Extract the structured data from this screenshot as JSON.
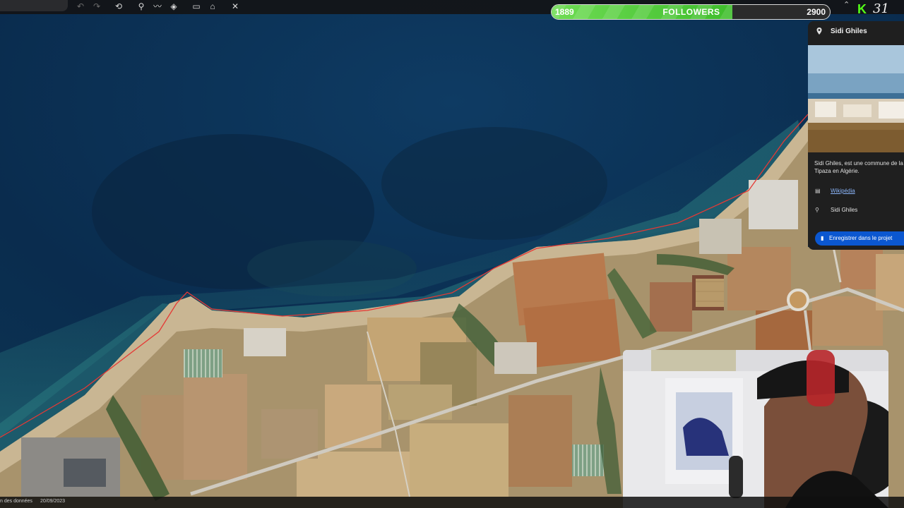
{
  "toolbar": {
    "icons": [
      "undo-icon",
      "redo-icon",
      "history-icon",
      "placemark-icon",
      "path-icon",
      "layers-icon",
      "ruler-icon",
      "street-view-icon",
      "settings-icon"
    ]
  },
  "followers_widget": {
    "current": "1889",
    "label": "FOLLOWERS",
    "goal": "2900",
    "progress": 0.651
  },
  "stream": {
    "platform_icon": "kick-logo",
    "viewer_count": "31"
  },
  "place_panel": {
    "title": "Sidi Ghiles",
    "description_lines": [
      "Sidi Ghiles, est une commune de la",
      "Tipaza en Algérie."
    ],
    "wiki_link": "Wikipédia",
    "location_label": "Sidi Ghiles",
    "save_button": "Enregistrer dans le projet"
  },
  "status_bar": {
    "data_credit": "n des données",
    "date": "20/09/2023"
  },
  "colors": {
    "accent_blue": "#0b57d0",
    "progress_green": "#4fd336",
    "kick_green": "#53fc18",
    "coast_line": "#e53935"
  }
}
